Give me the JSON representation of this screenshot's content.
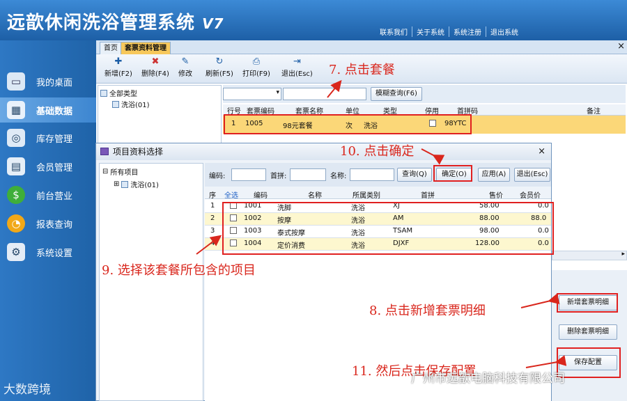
{
  "app": {
    "title": "远歆休闲洗浴管理系统",
    "version": "V7"
  },
  "top_links": [
    "联系我们",
    "关于系统",
    "系统注册",
    "退出系统"
  ],
  "sidebar": {
    "items": [
      {
        "label": "我的桌面",
        "icon": "desktop-icon"
      },
      {
        "label": "基础数据",
        "icon": "database-icon"
      },
      {
        "label": "库存管理",
        "icon": "stock-icon"
      },
      {
        "label": "会员管理",
        "icon": "member-icon"
      },
      {
        "label": "前台营业",
        "icon": "dollar-icon"
      },
      {
        "label": "报表查询",
        "icon": "report-icon"
      },
      {
        "label": "系统设置",
        "icon": "gear-icon"
      }
    ],
    "active": 1
  },
  "tabs": [
    {
      "label": "首页"
    },
    {
      "label": "套票资料管理"
    }
  ],
  "tab_close": "×",
  "toolbar": {
    "new": "新增(F2)",
    "delete": "删除(F4)",
    "edit": "修改",
    "refresh": "刷新(F5)",
    "print": "打印(F9)",
    "exit": "退出(Esc)"
  },
  "tree": {
    "root": "全部类型",
    "child": "洗浴(01)"
  },
  "search": {
    "fuzzy_button": "模糊查询(F6)"
  },
  "grid": {
    "headers": [
      "行号",
      "套票编码",
      "套票名称",
      "单位",
      "类型",
      "停用",
      "首拼码",
      "备注"
    ],
    "row": {
      "no": "1",
      "code": "1005",
      "name": "98元套餐",
      "unit": "次",
      "type": "洗浴",
      "pinyin": "98YTC"
    }
  },
  "right_buttons": {
    "add_detail": "新增套票明细",
    "delete_detail": "删除套票明细",
    "save": "保存配置"
  },
  "dialog": {
    "title": "项目资料选择",
    "close": "×",
    "tree": {
      "root": "所有项目",
      "child": "洗浴(01)"
    },
    "labels": {
      "code": "编码:",
      "pinyin": "首拼:",
      "name": "名称:"
    },
    "buttons": {
      "query": "查询(Q)",
      "confirm": "确定(O)",
      "apply": "应用(A)",
      "exit": "退出(Esc)"
    },
    "headers": [
      "序",
      "全选",
      "编码",
      "名称",
      "所属类别",
      "首拼",
      "售价",
      "会员价"
    ],
    "rows": [
      {
        "no": "1",
        "code": "1001",
        "name": "洗脚",
        "category": "洗浴",
        "pinyin": "XJ",
        "price": "58.00",
        "member": "0.0"
      },
      {
        "no": "2",
        "code": "1002",
        "name": "按摩",
        "category": "洗浴",
        "pinyin": "AM",
        "price": "88.00",
        "member": "88.0"
      },
      {
        "no": "3",
        "code": "1003",
        "name": "泰式按摩",
        "category": "洗浴",
        "pinyin": "TSAM",
        "price": "98.00",
        "member": "0.0"
      },
      {
        "no": "4",
        "code": "1004",
        "name": "定价消费",
        "category": "洗浴",
        "pinyin": "DJXF",
        "price": "128.00",
        "member": "0.0"
      }
    ]
  },
  "annotations": {
    "a7": "7. 点击套餐",
    "a8": "8. 点击新增套票明细",
    "a9": "9. 选择该套餐所包含的项目",
    "a10": "10. 点击确定",
    "a11": "11. 然后点击保存配置"
  },
  "watermarks": {
    "left": "大数跨境",
    "right": "广州市远歆电脑科技有限公司"
  }
}
